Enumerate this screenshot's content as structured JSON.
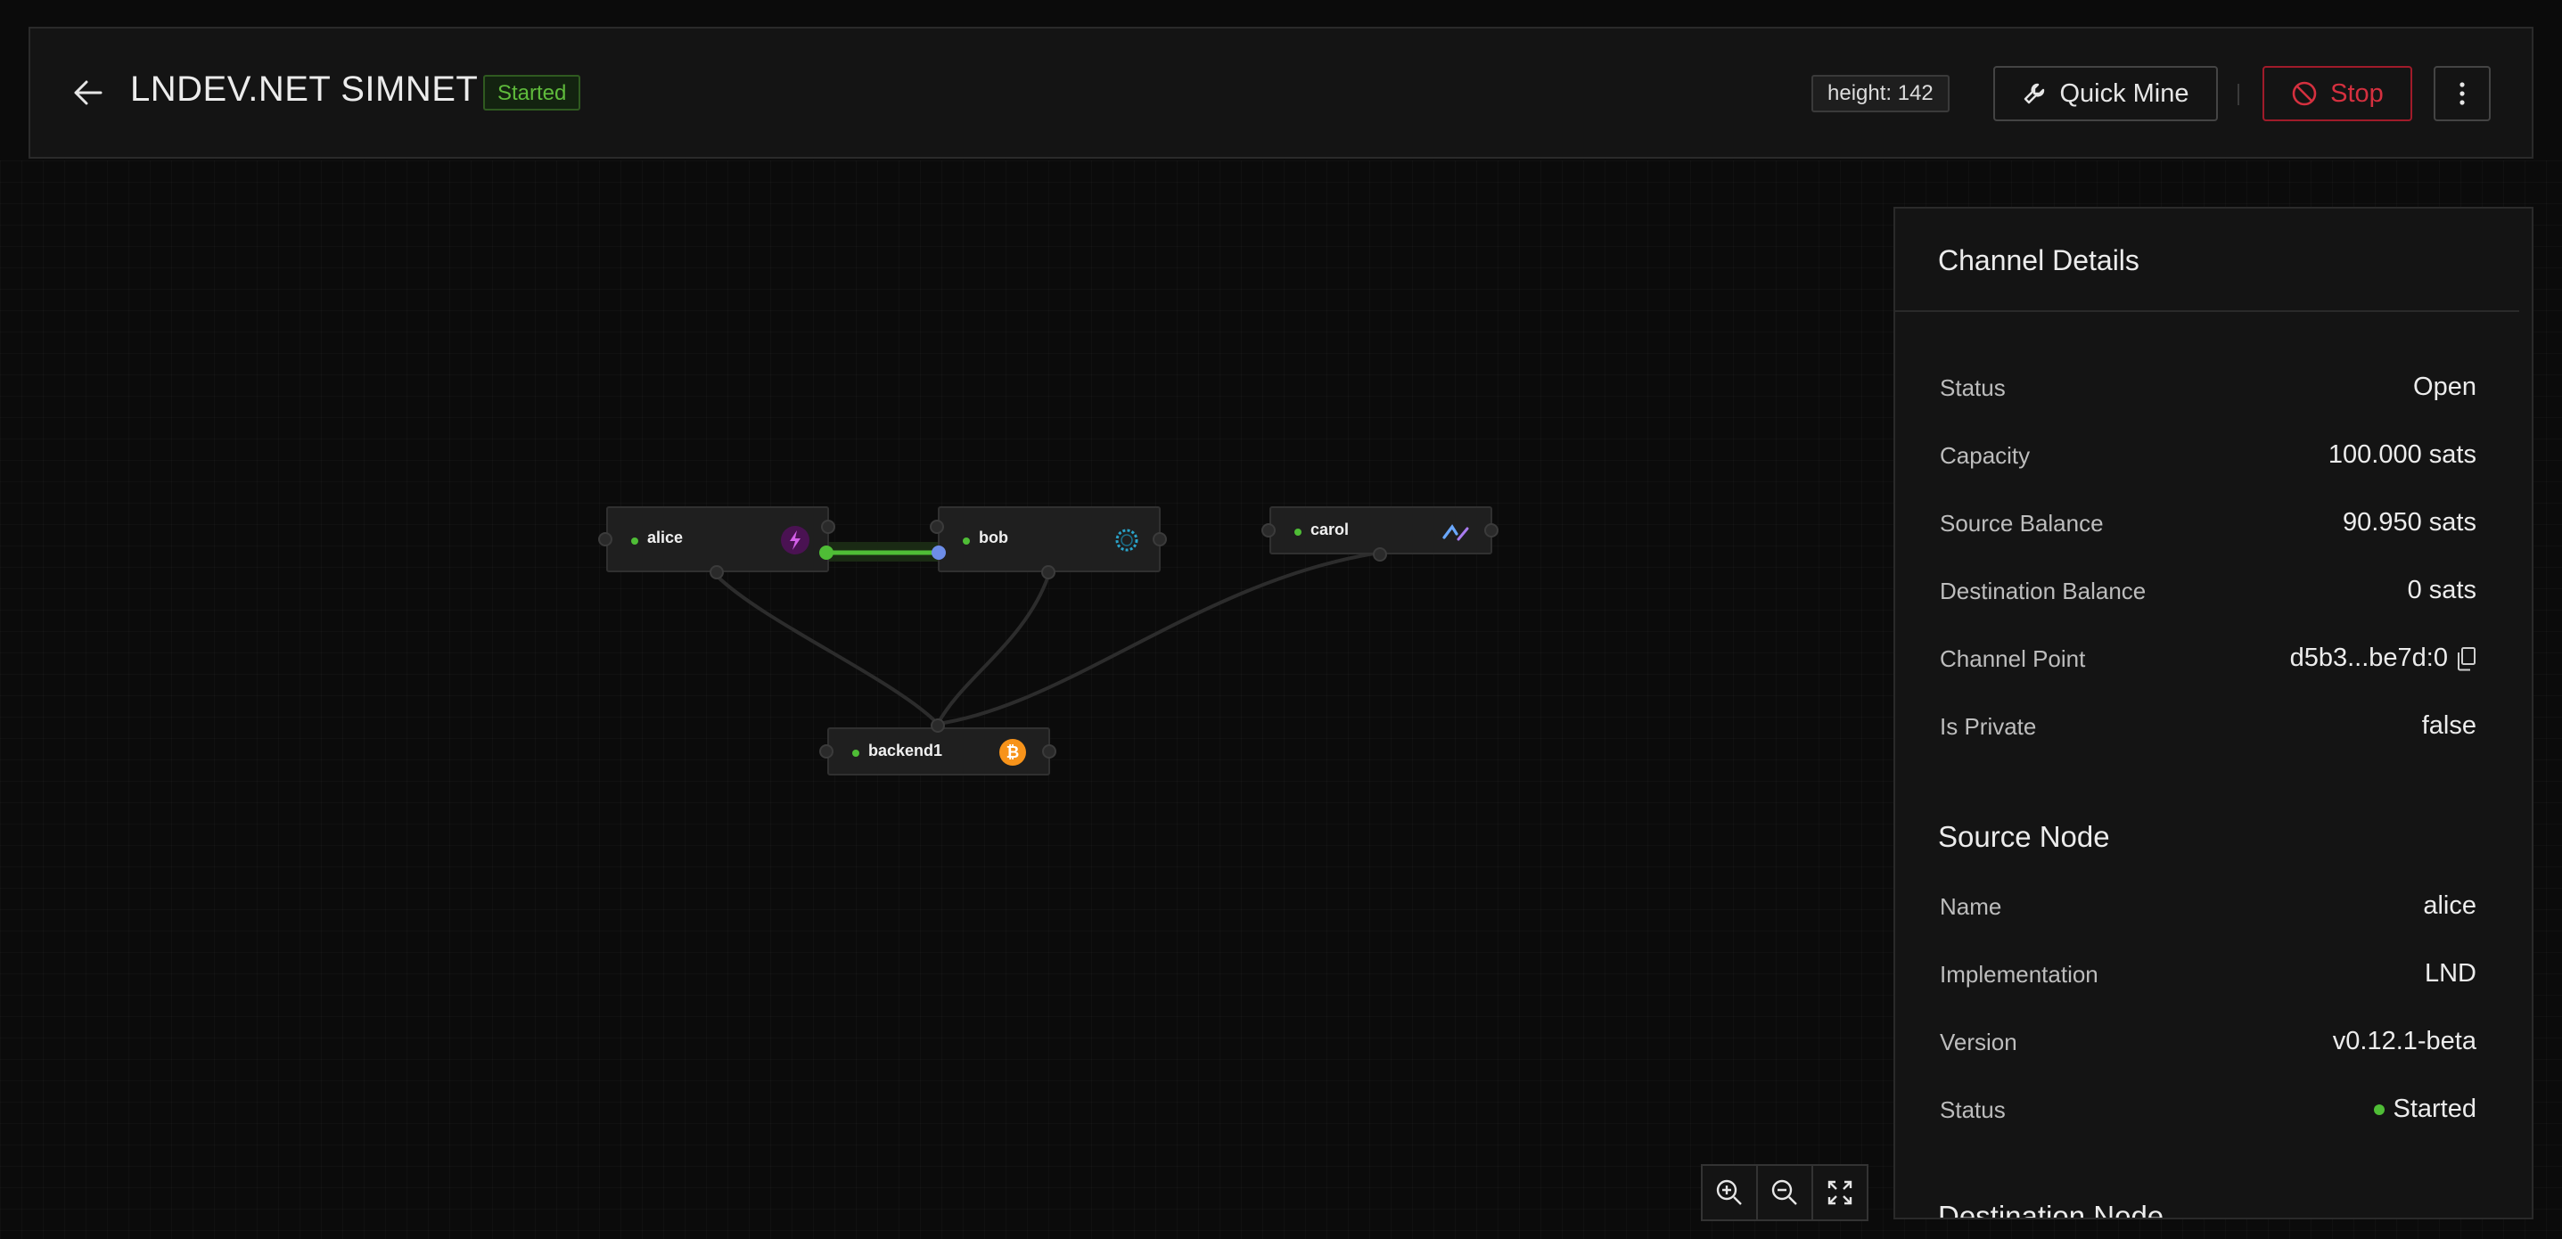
{
  "header": {
    "title": "LNDEV.NET SIMNET",
    "status_tag": "Started",
    "height_label": "height: 142",
    "quick_mine_label": "Quick Mine",
    "stop_label": "Stop"
  },
  "nodes": [
    {
      "name": "alice",
      "icon": "lightning-icon"
    },
    {
      "name": "bob",
      "icon": "eclair-ring-icon"
    },
    {
      "name": "carol",
      "icon": "c-lightning-icon"
    },
    {
      "name": "backend1",
      "icon": "bitcoin-icon"
    }
  ],
  "details": {
    "title": "Channel Details",
    "rows": [
      {
        "label": "Status",
        "value": "Open"
      },
      {
        "label": "Capacity",
        "value": "100.000 sats"
      },
      {
        "label": "Source Balance",
        "value": "90.950 sats"
      },
      {
        "label": "Destination Balance",
        "value": "0 sats"
      },
      {
        "label": "Channel Point",
        "value": "d5b3...be7d:0"
      },
      {
        "label": "Is Private",
        "value": "false"
      }
    ],
    "source_node": {
      "title": "Source Node",
      "rows": [
        {
          "label": "Name",
          "value": "alice"
        },
        {
          "label": "Implementation",
          "value": "LND"
        },
        {
          "label": "Version",
          "value": "v0.12.1-beta"
        },
        {
          "label": "Status",
          "value": "Started"
        }
      ]
    },
    "destination_title": "Destination Node"
  },
  "colors": {
    "accent_green": "#4fbd36",
    "stop_red": "#d5303f",
    "background": "#0b0b0b"
  }
}
